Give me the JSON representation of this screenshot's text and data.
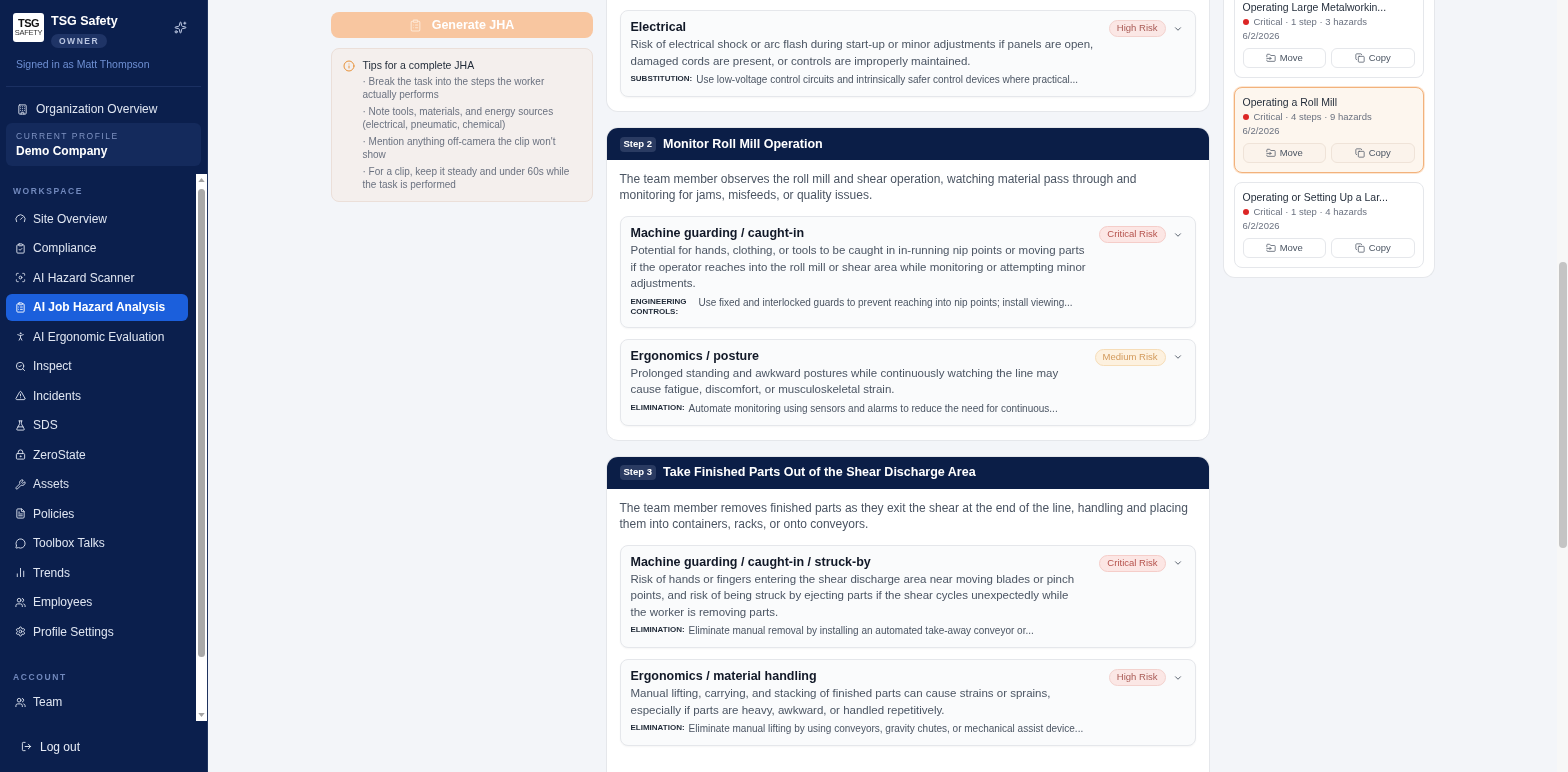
{
  "sidebar": {
    "logo": {
      "text": "TSG",
      "subtext": "SAFETY"
    },
    "brand": "TSG Safety",
    "role": "OWNER",
    "signed_in": "Signed in as Matt Thompson",
    "org_link": "Organization Overview",
    "profile": {
      "label": "CURRENT PROFILE",
      "name": "Demo Company"
    },
    "sections": [
      {
        "title": "WORKSPACE",
        "items": [
          {
            "label": "Site Overview",
            "selected": false
          },
          {
            "label": "Compliance",
            "selected": false
          },
          {
            "label": "AI Hazard Scanner",
            "selected": false
          },
          {
            "label": "AI Job Hazard Analysis",
            "selected": true
          },
          {
            "label": "AI Ergonomic Evaluation",
            "selected": false
          },
          {
            "label": "Inspect",
            "selected": false
          },
          {
            "label": "Incidents",
            "selected": false
          },
          {
            "label": "SDS",
            "selected": false
          },
          {
            "label": "ZeroState",
            "selected": false
          },
          {
            "label": "Assets",
            "selected": false
          },
          {
            "label": "Policies",
            "selected": false
          },
          {
            "label": "Toolbox Talks",
            "selected": false
          },
          {
            "label": "Trends",
            "selected": false
          },
          {
            "label": "Employees",
            "selected": false
          },
          {
            "label": "Profile Settings",
            "selected": false
          }
        ]
      },
      {
        "title": "ACCOUNT",
        "items": [
          {
            "label": "Team",
            "selected": false
          }
        ]
      }
    ],
    "logout": "Log out"
  },
  "generate_button": {
    "label": "Generate JHA",
    "disabled": true
  },
  "tips": {
    "title": "Tips for a complete JHA",
    "items": [
      "· Break the task into the steps the worker actually performs",
      "· Note tools, materials, and energy sources (electrical, pneumatic, chemical)",
      "· Mention anything off-camera the clip won't show",
      "· For a clip, keep it steady and under 60s while the task is performed"
    ]
  },
  "steps": [
    {
      "hazards": [
        {
          "title": "Electrical",
          "kind": "high",
          "risk_label": "High Risk",
          "description": "Risk of electrical shock or arc flash during start-up or minor adjustments if panels are open, damaged cords are present, or controls are improperly maintained.",
          "control_label": "SUBSTITUTION:",
          "control": "Use low-voltage control circuits and intrinsically safer control devices where practical..."
        }
      ]
    },
    {
      "badge": "Step 2",
      "title": "Monitor Roll Mill Operation",
      "description": "The team member observes the roll mill and shear operation, watching material pass through and monitoring for jams, misfeeds, or quality issues.",
      "hazards": [
        {
          "title": "Machine guarding / caught-in",
          "kind": "critical",
          "risk_label": "Critical Risk",
          "description": "Potential for hands, clothing, or tools to be caught in in-running nip points or moving parts if the operator reaches into the roll mill or shear area while monitoring or attempting minor adjustments.",
          "control_label": "ENGINEERING CONTROLS:",
          "control": "Use fixed and interlocked guards to prevent reaching into nip points; install viewing..."
        },
        {
          "title": "Ergonomics / posture",
          "kind": "medium",
          "risk_label": "Medium Risk",
          "description": "Prolonged standing and awkward postures while continuously watching the line may cause fatigue, discomfort, or musculoskeletal strain.",
          "control_label": "ELIMINATION:",
          "control": "Automate monitoring using sensors and alarms to reduce the need for continuous..."
        }
      ]
    },
    {
      "badge": "Step 3",
      "title": "Take Finished Parts Out of the Shear Discharge Area",
      "description": "The team member removes finished parts as they exit the shear at the end of the line, handling and placing them into containers, racks, or onto conveyors.",
      "hazards": [
        {
          "title": "Machine guarding / caught-in / struck-by",
          "kind": "critical",
          "risk_label": "Critical Risk",
          "description": "Risk of hands or fingers entering the shear discharge area near moving blades or pinch points, and risk of being struck by ejecting parts if the shear cycles unexpectedly while the worker is removing parts.",
          "control_label": "ELIMINATION:",
          "control": "Eliminate manual removal by installing an automated take-away conveyor or..."
        },
        {
          "title": "Ergonomics / material handling",
          "kind": "high",
          "risk_label": "High Risk",
          "description": "Manual lifting, carrying, and stacking of finished parts can cause strains or sprains, especially if parts are heavy, awkward, or handled repetitively.",
          "control_label": "ELIMINATION:",
          "control": "Eliminate manual lifting by using conveyors, gravity chutes, or mechanical assist device..."
        }
      ]
    }
  ],
  "jha_list": [
    {
      "title": "Operating Large Metalworkin...",
      "meta": "Critical · 1 step · 3 hazards",
      "date": "6/2/2026",
      "selected": false,
      "actions": [
        "Move",
        "Copy"
      ]
    },
    {
      "title": "Operating a Roll Mill",
      "meta": "Critical · 4 steps · 9 hazards",
      "date": "6/2/2026",
      "selected": true,
      "actions": [
        "Move",
        "Copy"
      ]
    },
    {
      "title": "Operating or Setting Up a Lar...",
      "meta": "Critical · 1 step · 4 hazards",
      "date": "6/2/2026",
      "selected": false,
      "actions": [
        "Move",
        "Copy"
      ]
    }
  ]
}
